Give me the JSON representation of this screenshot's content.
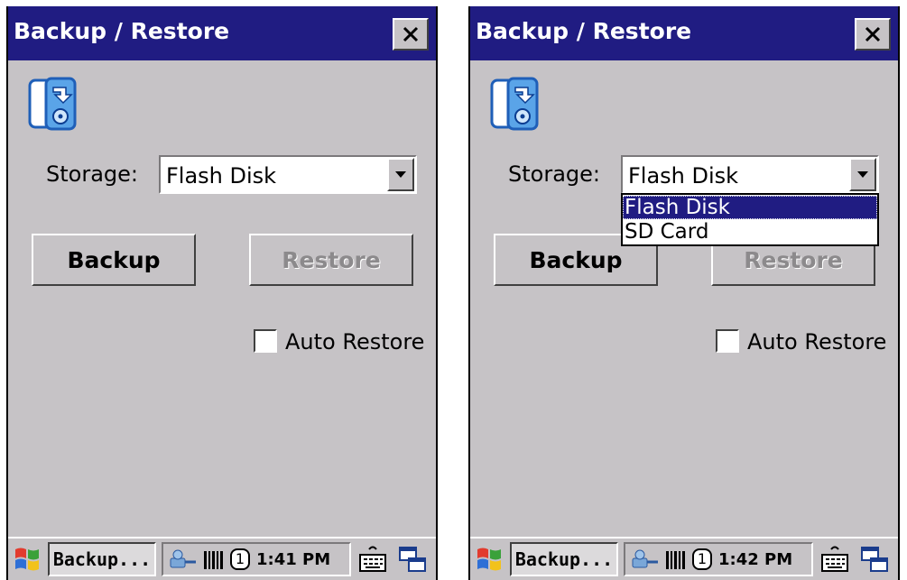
{
  "screens": [
    {
      "title": "Backup / Restore",
      "storage_label": "Storage:",
      "storage_value": "Flash Disk",
      "backup_label": "Backup",
      "restore_label": "Restore",
      "auto_restore_label": "Auto Restore",
      "auto_restore_checked": false,
      "taskbar": {
        "task_label": "Backup...",
        "clock": "1:41 PM",
        "tray_number": "1"
      }
    },
    {
      "title": "Backup / Restore",
      "storage_label": "Storage:",
      "storage_value": "Flash Disk",
      "dropdown_options": [
        "Flash Disk",
        "SD Card"
      ],
      "dropdown_selected": "Flash Disk",
      "backup_label": "Backup",
      "restore_label": "Restore",
      "auto_restore_label": "Auto Restore",
      "auto_restore_checked": false,
      "taskbar": {
        "task_label": "Backup...",
        "clock": "1:42 PM",
        "tray_number": "1"
      }
    }
  ],
  "icons": {
    "close": "close-icon",
    "app": "backup-restore-icon",
    "dropdown_arrow": "chevron-down-icon",
    "start": "windows-start-icon",
    "network": "network-icon",
    "barcode": "barcode-icon",
    "keyboard": "keyboard-icon",
    "windows": "desktop-icon"
  },
  "colors": {
    "titlebar": "#201c82",
    "window_bg": "#c6c3c6",
    "selection": "#201c82",
    "disabled_text": "#8c8a8c"
  }
}
